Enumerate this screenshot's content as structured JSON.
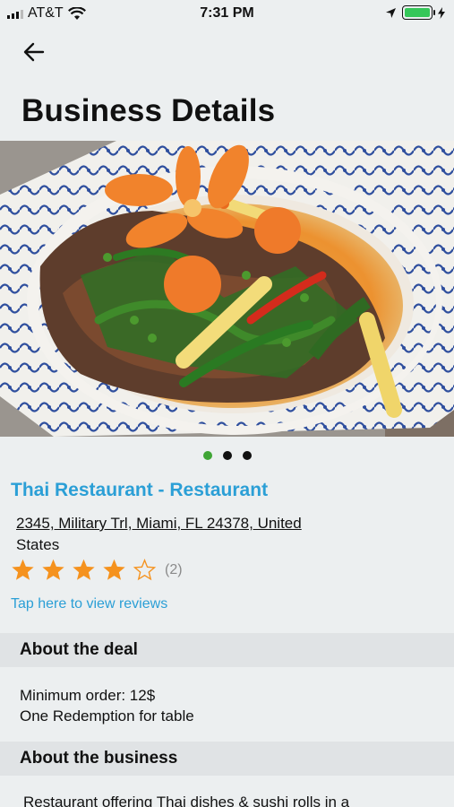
{
  "status_bar": {
    "carrier": "AT&T",
    "time": "7:31 PM",
    "icons": [
      "signal-icon",
      "wifi-icon",
      "location-arrow-icon",
      "battery-icon",
      "charging-bolt-icon"
    ],
    "battery_color": "#35c759"
  },
  "header": {
    "title": "Business Details",
    "back_icon": "back-arrow-icon"
  },
  "carousel": {
    "pages": 3,
    "active_index": 0,
    "active_color": "#3fa535"
  },
  "business": {
    "name": "Thai Restaurant - Restaurant",
    "address_line1": "2345, Military Trl, Miami, FL  24378, United",
    "address_line2": "States",
    "rating": 4,
    "rating_max": 5,
    "review_count": "(2)",
    "view_reviews": "Tap here to view reviews",
    "accent_color": "#2b9fd6",
    "star_color": "#f5921e"
  },
  "about_deal": {
    "title": "About the deal",
    "line1": "Minimum order: 12$",
    "line2": "One Redemption for table"
  },
  "about_business": {
    "title": "About the business",
    "description": "Restaurant offering Thai dishes & sushi rolls in a"
  }
}
